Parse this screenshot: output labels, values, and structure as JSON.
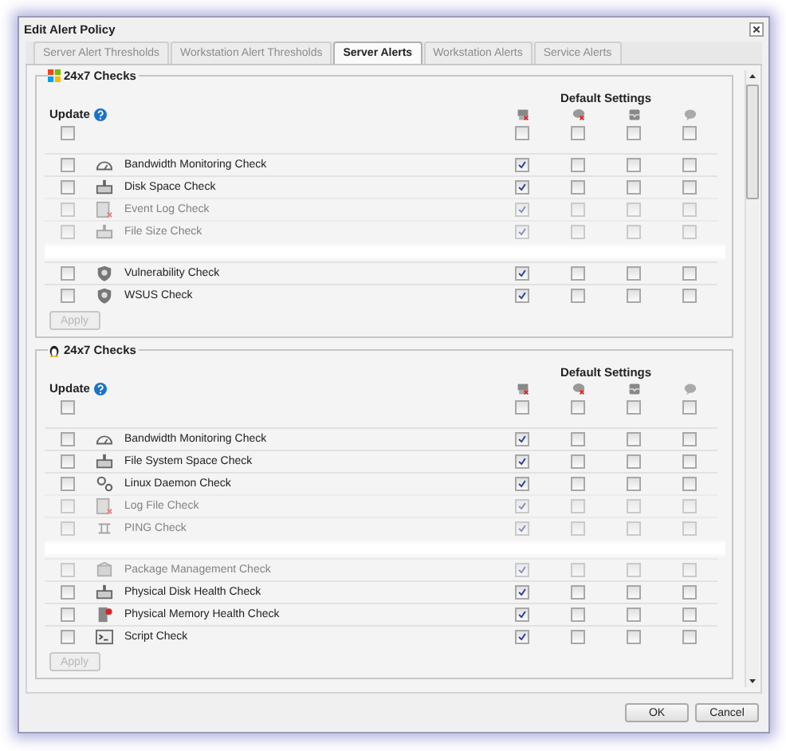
{
  "window": {
    "title": "Edit Alert Policy"
  },
  "tabs": [
    {
      "label": "Server Alert Thresholds",
      "selected": false,
      "disabled": true
    },
    {
      "label": "Workstation Alert Thresholds",
      "selected": false,
      "disabled": true
    },
    {
      "label": "Server Alerts",
      "selected": true,
      "disabled": false
    },
    {
      "label": "Workstation Alerts",
      "selected": false,
      "disabled": true
    },
    {
      "label": "Service Alerts",
      "selected": false,
      "disabled": true
    }
  ],
  "sections": [
    {
      "kind": "windows",
      "title": "24x7 Checks",
      "update_label": "Update",
      "default_settings_label": "Default Settings",
      "header_update": false,
      "header_defaults": [
        false,
        false,
        false,
        false
      ],
      "rows": [
        {
          "name": "Bandwidth Monitoring Check",
          "kind": "gauge",
          "update": false,
          "defaults": [
            true,
            false,
            false,
            false
          ],
          "faded": false,
          "break_after": false
        },
        {
          "name": "Disk Space Check",
          "kind": "disk",
          "update": false,
          "defaults": [
            true,
            false,
            false,
            false
          ],
          "faded": false,
          "break_after": false
        },
        {
          "name": "Event Log Check",
          "kind": "log",
          "update": false,
          "defaults": [
            true,
            false,
            false,
            false
          ],
          "faded": true,
          "break_after": false
        },
        {
          "name": "File Size Check",
          "kind": "disk",
          "update": false,
          "defaults": [
            true,
            false,
            false,
            false
          ],
          "faded": true,
          "break_after": true
        },
        {
          "name": "Vulnerability Check",
          "kind": "shield",
          "update": false,
          "defaults": [
            true,
            false,
            false,
            false
          ],
          "faded": false,
          "break_after": false
        },
        {
          "name": "WSUS Check",
          "kind": "shield",
          "update": false,
          "defaults": [
            true,
            false,
            false,
            false
          ],
          "faded": false,
          "break_after": false
        }
      ],
      "apply": {
        "label": "Apply",
        "disabled": true
      }
    },
    {
      "kind": "linux",
      "title": "24x7 Checks",
      "update_label": "Update",
      "default_settings_label": "Default Settings",
      "header_update": false,
      "header_defaults": [
        false,
        false,
        false,
        false
      ],
      "rows": [
        {
          "name": "Bandwidth Monitoring Check",
          "kind": "gauge",
          "update": false,
          "defaults": [
            true,
            false,
            false,
            false
          ],
          "faded": false,
          "break_after": false
        },
        {
          "name": "File System Space Check",
          "kind": "disk",
          "update": false,
          "defaults": [
            true,
            false,
            false,
            false
          ],
          "faded": false,
          "break_after": false
        },
        {
          "name": "Linux Daemon Check",
          "kind": "gears",
          "update": false,
          "defaults": [
            true,
            false,
            false,
            false
          ],
          "faded": false,
          "break_after": false
        },
        {
          "name": "Log File Check",
          "kind": "log",
          "update": false,
          "defaults": [
            true,
            false,
            false,
            false
          ],
          "faded": true,
          "break_after": false
        },
        {
          "name": "PING Check",
          "kind": "network",
          "update": false,
          "defaults": [
            true,
            false,
            false,
            false
          ],
          "faded": true,
          "break_after": true
        },
        {
          "name": "Package Management Check",
          "kind": "package",
          "update": false,
          "defaults": [
            true,
            false,
            false,
            false
          ],
          "faded": true,
          "break_after": false
        },
        {
          "name": "Physical Disk Health Check",
          "kind": "disk",
          "update": false,
          "defaults": [
            true,
            false,
            false,
            false
          ],
          "faded": false,
          "break_after": false
        },
        {
          "name": "Physical Memory Health Check",
          "kind": "memory",
          "update": false,
          "defaults": [
            true,
            false,
            false,
            false
          ],
          "faded": false,
          "break_after": false
        },
        {
          "name": "Script Check",
          "kind": "script",
          "update": false,
          "defaults": [
            true,
            false,
            false,
            false
          ],
          "faded": false,
          "break_after": false
        }
      ],
      "apply": {
        "label": "Apply",
        "disabled": true
      }
    }
  ],
  "buttons": [
    {
      "label": "OK"
    },
    {
      "label": "Cancel"
    }
  ]
}
